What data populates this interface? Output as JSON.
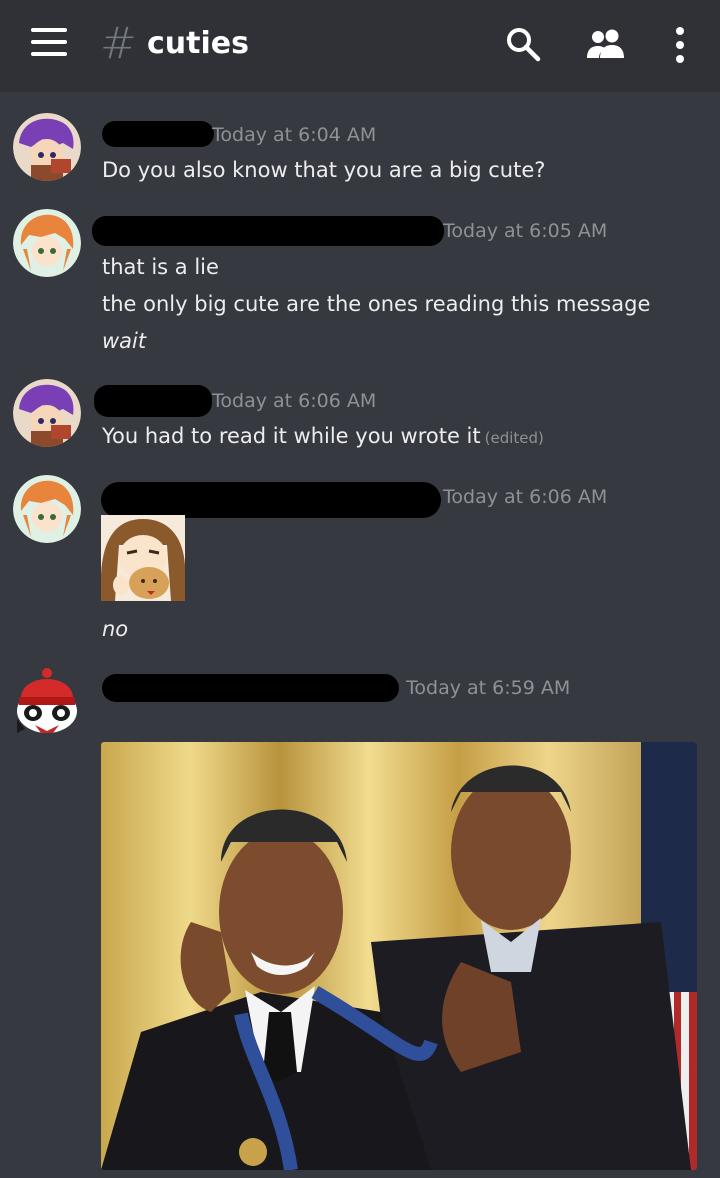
{
  "header": {
    "hash": "#",
    "channel_name": "cuties",
    "icons": [
      "menu-icon",
      "search-icon",
      "members-icon",
      "more-options-icon"
    ]
  },
  "messages": [
    {
      "timestamp": "Today at 6:04 AM",
      "lines": [
        "Do you also know that you are a big cute?"
      ]
    },
    {
      "timestamp": "Today at 6:05 AM",
      "lines": [
        "that is a lie",
        "the only big cute are the ones reading this message",
        "wait"
      ]
    },
    {
      "timestamp": "Today at 6:06 AM",
      "lines": [
        "You had to read it while you wrote it"
      ],
      "edited": "(edited)"
    },
    {
      "timestamp": "Today at 6:06 AM",
      "lines": [
        "no"
      ]
    },
    {
      "timestamp": "Today at 6:59 AM",
      "lines": []
    }
  ],
  "colors": {
    "background": "#36393f",
    "topbar": "#2f3136",
    "timestamp": "#8e9297",
    "text": "#ecedee"
  }
}
